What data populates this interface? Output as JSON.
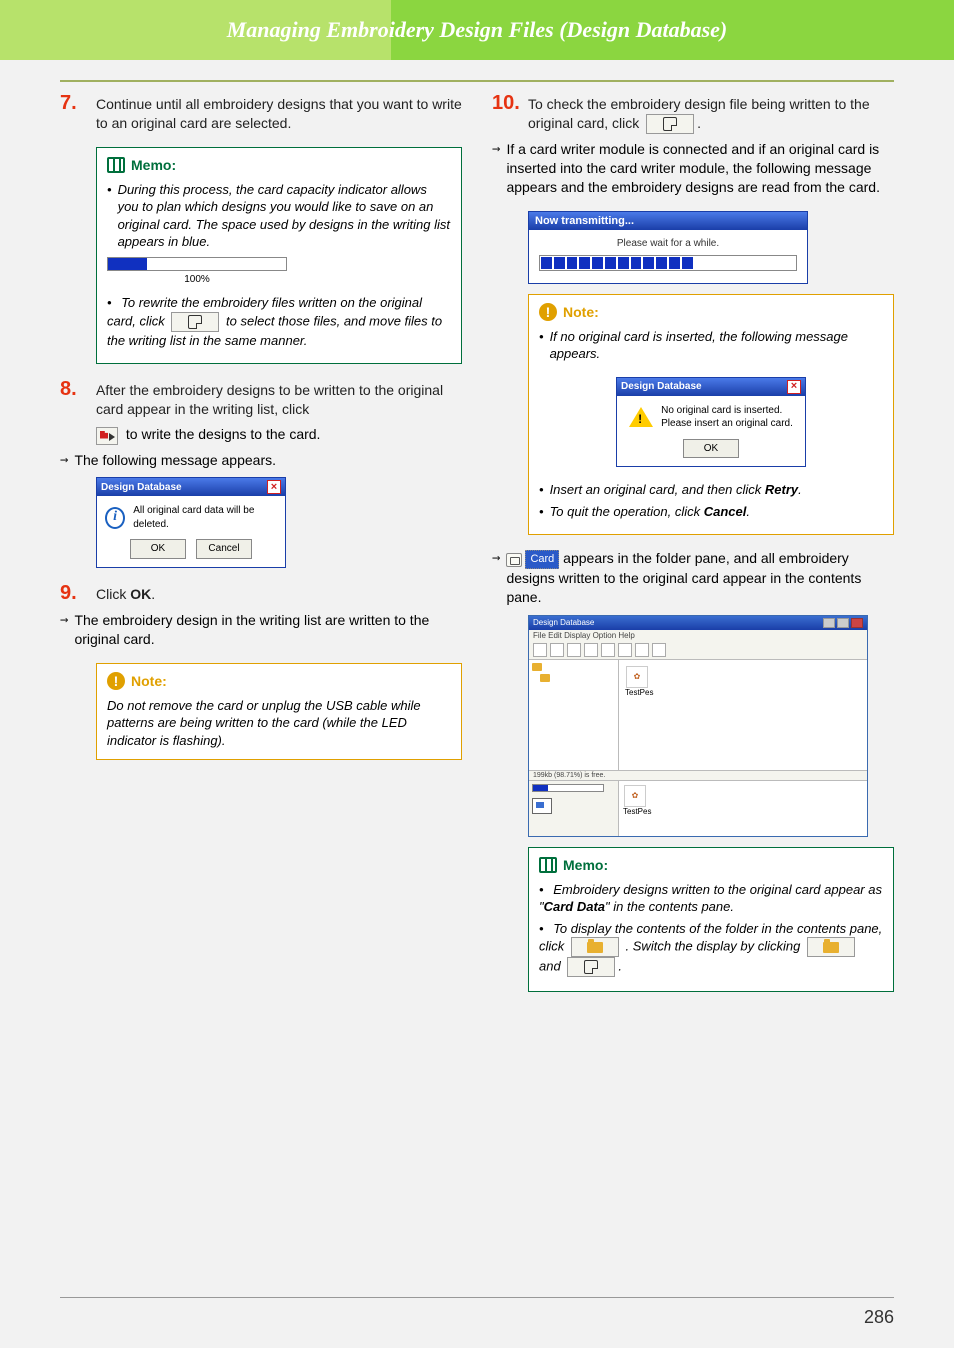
{
  "header": {
    "title": "Managing Embroidery Design Files (Design Database)"
  },
  "left": {
    "step7": {
      "num": "7.",
      "text": "Continue until all embroidery designs that you want to write to an original card are selected."
    },
    "memo1": {
      "title": "Memo:",
      "bullet1": "During this process, the card capacity indicator allows you to plan which designs you would like to save on an original card. The space used by designs in the writing list appears in blue.",
      "progress_label": "100%",
      "line2a": "To rewrite the embroidery files written on the original card, click",
      "line2b": "to select those files, and move files to the writing list in the same manner."
    },
    "step8": {
      "num": "8.",
      "text": "After the embroidery designs to be written to the original card appear in the writing list, click",
      "line2": "to write the designs to the card.",
      "line3": "The following message appears."
    },
    "dialog1": {
      "title": "Design Database",
      "msg": "All original card data will be deleted.",
      "ok": "OK",
      "cancel": "Cancel"
    },
    "step9": {
      "num": "9.",
      "text_a": "Click ",
      "text_b": "OK",
      "text_c": ".",
      "line2": "The embroidery design in the writing list are written to the original card."
    },
    "note1": {
      "title": "Note:",
      "text": "Do not remove the card or unplug the USB cable while patterns are being written to the card (while the LED indicator is flashing)."
    }
  },
  "right": {
    "step10": {
      "num": "10.",
      "text_a": "To check the embroidery design file being written to the original card, click",
      "text_b": ".",
      "line2": "If a card writer module is connected and if an original card is inserted into the card writer module, the following message appears and the embroidery designs are read from the card."
    },
    "transmit": {
      "title": "Now transmitting...",
      "msg": "Please wait for a while."
    },
    "note2": {
      "title": "Note:",
      "bullet1": "If no original card is inserted, the following message appears.",
      "dialog": {
        "title": "Design Database",
        "line1": "No original card is inserted.",
        "line2": "Please insert an original card.",
        "ok": "OK"
      },
      "bullet2a": "Insert an original card, and then click ",
      "bullet2b": "Retry",
      "bullet2c": ".",
      "bullet3a": "To quit the operation, click ",
      "bullet3b": "Cancel",
      "bullet3c": "."
    },
    "card_line_a": "appears in the folder pane, and all embroidery designs written to the original card appear in the contents pane.",
    "card_label": "Card",
    "app": {
      "title": "Design Database",
      "menu": "File  Edit  Display  Option  Help",
      "thumb1": "TestPes",
      "thumb2": "TestPes",
      "cap_label": "199kb (98.71%) is free."
    },
    "memo2": {
      "title": "Memo:",
      "bullet1a": "Embroidery designs written to the original card appear as \"",
      "bullet1b": "Card Data",
      "bullet1c": "\" in the contents pane.",
      "bullet2a": "To display the contents of the folder in the contents pane, click",
      "bullet2b": ". Switch the display by clicking",
      "bullet2c": "and",
      "bullet2d": "."
    }
  },
  "page_number": "286"
}
